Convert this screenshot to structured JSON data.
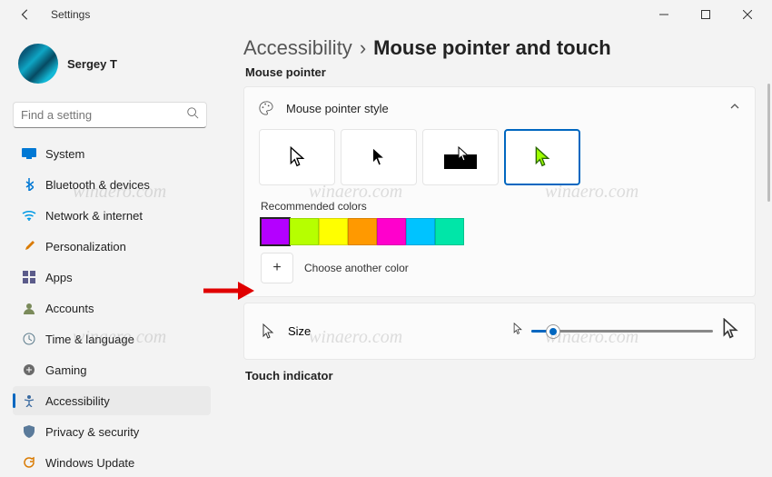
{
  "window": {
    "title": "Settings"
  },
  "profile": {
    "name": "Sergey T"
  },
  "search": {
    "placeholder": "Find a setting"
  },
  "nav": {
    "items": [
      {
        "label": "System"
      },
      {
        "label": "Bluetooth & devices"
      },
      {
        "label": "Network & internet"
      },
      {
        "label": "Personalization"
      },
      {
        "label": "Apps"
      },
      {
        "label": "Accounts"
      },
      {
        "label": "Time & language"
      },
      {
        "label": "Gaming"
      },
      {
        "label": "Accessibility"
      },
      {
        "label": "Privacy & security"
      },
      {
        "label": "Windows Update"
      }
    ],
    "active_index": 8
  },
  "breadcrumb": {
    "parent": "Accessibility",
    "sep": "›",
    "current": "Mouse pointer and touch"
  },
  "sections": {
    "mouse_pointer_label": "Mouse pointer",
    "style_header": "Mouse pointer style",
    "recommended_label": "Recommended colors",
    "choose_another": "Choose another color",
    "size_label": "Size",
    "touch_label": "Touch indicator"
  },
  "colors": {
    "swatches": [
      "#b400ff",
      "#b6ff00",
      "#ffff00",
      "#ff9900",
      "#ff00cc",
      "#00c3ff",
      "#00e6a8"
    ],
    "selected_index": 0
  },
  "pointer_styles": {
    "selected_index": 3
  },
  "size_slider": {
    "value_percent": 12
  },
  "watermark": "winaero.com"
}
